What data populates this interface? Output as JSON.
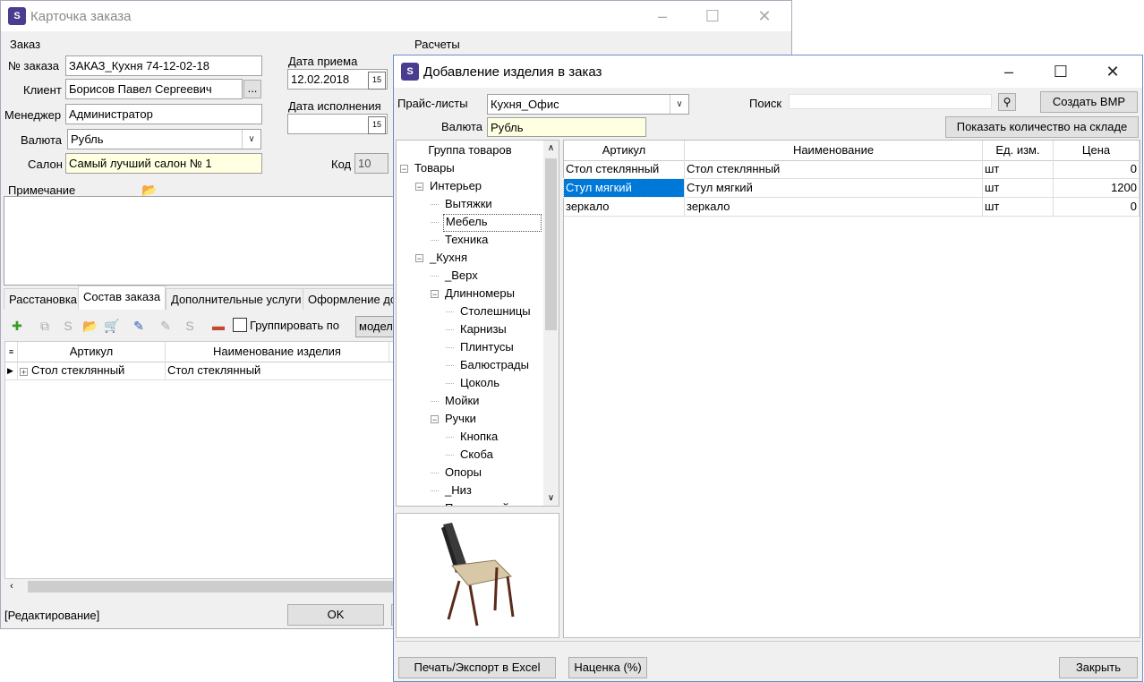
{
  "back_window": {
    "title": "Карточка заказа",
    "group_order": "Заказ",
    "group_calc": "Расчеты",
    "order_no_label": "№ заказа",
    "order_no_value": "ЗАКАЗ_Кухня 74-12-02-18",
    "client_label": "Клиент",
    "client_value": "Борисов Павел Сергеевич",
    "client_browse": "...",
    "manager_label": "Менеджер",
    "manager_value": "Администратор",
    "currency_label": "Валюта",
    "currency_value": "Рубль",
    "salon_label": "Салон",
    "salon_value": "Самый лучший салон № 1",
    "date_accept_label": "Дата приема",
    "date_accept_value": "12.02.2018",
    "date_exec_label": "Дата исполнения",
    "date_exec_value": "",
    "code_label": "Код",
    "code_value": "10",
    "note_label": "Примечание",
    "tabs": [
      "Расстановка",
      "Состав заказа",
      "Дополнительные услуги",
      "Оформление до"
    ],
    "group_check_label": "Группировать по",
    "group_by_value": "модель",
    "grid_headers": [
      "Артикул",
      "Наименование изделия"
    ],
    "grid_rows": [
      {
        "article": "Стол стеклянный",
        "name": "Стол стеклянный"
      }
    ],
    "status": "[Редактирование]",
    "ok_label": "OK"
  },
  "dialog": {
    "title": "Добавление изделия в заказ",
    "pricelist_label": "Прайс-листы",
    "pricelist_value": "Кухня_Офис",
    "search_label": "Поиск",
    "search_value": "",
    "create_bmp_label": "Создать BMP",
    "currency_label": "Валюта",
    "currency_value": "Рубль",
    "show_stock_label": "Показать количество на складе",
    "tree_header": "Группа товаров",
    "tree": [
      {
        "label": "Товары",
        "level": 0,
        "toggle": "−"
      },
      {
        "label": "Интерьер",
        "level": 1,
        "toggle": "−"
      },
      {
        "label": "Вытяжки",
        "level": 2,
        "toggle": ""
      },
      {
        "label": "Мебель",
        "level": 2,
        "toggle": "",
        "selected": true
      },
      {
        "label": "Техника",
        "level": 2,
        "toggle": ""
      },
      {
        "label": "_Кухня",
        "level": 1,
        "toggle": "−"
      },
      {
        "label": "_Верх",
        "level": 2,
        "toggle": ""
      },
      {
        "label": "Длинномеры",
        "level": 2,
        "toggle": "−"
      },
      {
        "label": "Столешницы",
        "level": 3,
        "toggle": ""
      },
      {
        "label": "Карнизы",
        "level": 3,
        "toggle": ""
      },
      {
        "label": "Плинтусы",
        "level": 3,
        "toggle": ""
      },
      {
        "label": "Балюстрады",
        "level": 3,
        "toggle": ""
      },
      {
        "label": "Цоколь",
        "level": 3,
        "toggle": ""
      },
      {
        "label": "Мойки",
        "level": 2,
        "toggle": ""
      },
      {
        "label": "Ручки",
        "level": 2,
        "toggle": "−"
      },
      {
        "label": "Кнопка",
        "level": 3,
        "toggle": ""
      },
      {
        "label": "Скоба",
        "level": 3,
        "toggle": ""
      },
      {
        "label": "Опоры",
        "level": 2,
        "toggle": ""
      },
      {
        "label": "_Низ",
        "level": 2,
        "toggle": ""
      },
      {
        "label": "Площадной матер",
        "level": 2,
        "toggle": ""
      }
    ],
    "grid_headers": [
      "Артикул",
      "Наименование",
      "Ед. изм.",
      "Цена"
    ],
    "grid_rows": [
      {
        "article": "Стол стеклянный",
        "name": "Стол стеклянный",
        "unit": "шт",
        "price": "0"
      },
      {
        "article": "Стул мягкий",
        "name": "Стул мягкий",
        "unit": "шт",
        "price": "1200",
        "selected": true
      },
      {
        "article": "зеркало",
        "name": "зеркало",
        "unit": "шт",
        "price": "0"
      }
    ],
    "print_label": "Печать/Экспорт в Excel",
    "markup_label": "Наценка (%)",
    "close_label": "Закрыть"
  },
  "colors": {
    "accent": "#0078d7",
    "readonly_bg": "#ffffe1",
    "app_icon": "#4a3d8f"
  }
}
